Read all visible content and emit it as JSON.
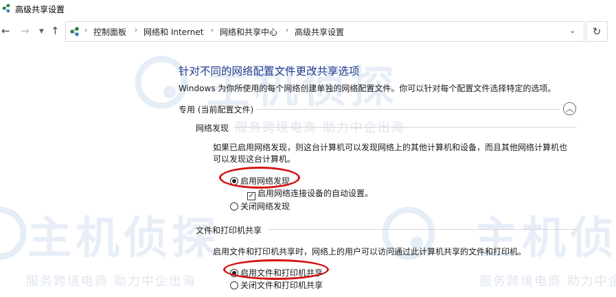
{
  "window": {
    "title": "高级共享设置"
  },
  "breadcrumb": [
    "控制面板",
    "网络和 Internet",
    "网络和共享中心",
    "高级共享设置"
  ],
  "page": {
    "heading": "针对不同的网络配置文件更改共享选项",
    "description": "Windows 为你所使用的每个网络创建单独的网络配置文件。你可以针对每个配置文件选择特定的选项。",
    "profile_label": "专用 (当前配置文件)",
    "network_discovery": {
      "title": "网络发现",
      "description": "如果已启用网络发现，则这台计算机可以发现网络上的其他计算机和设备，而且其他网络计算机也可以发现这台计算机。",
      "option_on": "启用网络发现",
      "option_on_selected": true,
      "auto_setup": "启用网络连接设备的自动设置。",
      "auto_setup_checked": true,
      "option_off": "关闭网络发现"
    },
    "file_printer_sharing": {
      "title": "文件和打印机共享",
      "description": "启用文件和打印机共享时，网络上的用户可以访问通过此计算机共享的文件和打印机。",
      "option_on": "启用文件和打印机共享",
      "option_on_selected": true,
      "option_off": "关闭文件和打印机共享"
    }
  },
  "watermark": {
    "logo": "主机侦探",
    "slogan": "服务跨境电商 助力中企出海"
  },
  "colors": {
    "heading": "#1e3a8a",
    "highlight": "#d31414",
    "watermark": "#a0b4cd"
  },
  "icons": {
    "app": "network-icon",
    "back": "arrow-left-icon",
    "forward": "arrow-right-icon",
    "recent": "chevron-down-icon",
    "up": "arrow-up-icon",
    "refresh": "refresh-icon",
    "collapse": "chevron-up-icon"
  }
}
